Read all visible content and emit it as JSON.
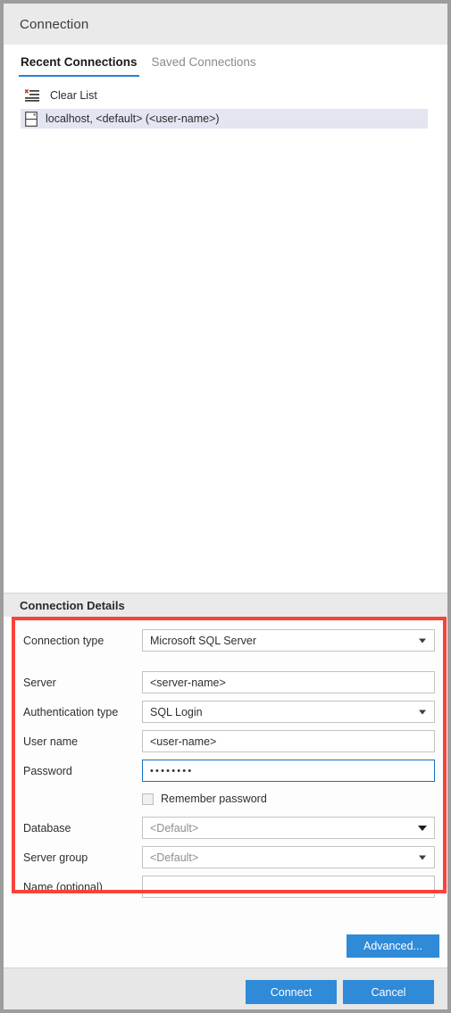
{
  "window": {
    "title": "Connection"
  },
  "tabs": [
    {
      "label": "Recent Connections",
      "active": true
    },
    {
      "label": "Saved Connections",
      "active": false
    }
  ],
  "recent": {
    "clear_list_label": "Clear List",
    "clear_list_icon": "clear-list-icon",
    "items": [
      {
        "label": "localhost, <default> (<user-name>)",
        "icon": "server-icon",
        "selected": true
      }
    ]
  },
  "details": {
    "header": "Connection Details",
    "fields": [
      {
        "label": "Connection type",
        "value": "Microsoft SQL Server",
        "type": "combo",
        "caret": "small",
        "dim": false,
        "focused": false
      },
      {
        "label": "Server",
        "value": "<server-name>",
        "type": "text",
        "caret": "none",
        "dim": false,
        "focused": false
      },
      {
        "label": "Authentication type",
        "value": "SQL Login",
        "type": "combo",
        "caret": "small",
        "dim": false,
        "focused": false
      },
      {
        "label": "User name",
        "value": "<user-name>",
        "type": "text",
        "caret": "none",
        "dim": false,
        "focused": false
      },
      {
        "label": "Password",
        "value": "••••••••",
        "type": "password",
        "caret": "none",
        "dim": false,
        "focused": true
      },
      {
        "label": "Database",
        "value": "<Default>",
        "type": "combo",
        "caret": "wide",
        "dim": true,
        "focused": false
      },
      {
        "label": "Server group",
        "value": "<Default>",
        "type": "combo",
        "caret": "small",
        "dim": true,
        "focused": false
      },
      {
        "label": "Name (optional)",
        "value": "",
        "type": "text",
        "caret": "none",
        "dim": false,
        "focused": false
      }
    ],
    "remember_password": {
      "label": "Remember password",
      "checked": false
    },
    "advanced_label": "Advanced..."
  },
  "footer": {
    "connect_label": "Connect",
    "cancel_label": "Cancel"
  },
  "colors": {
    "accent_blue": "#2f8ad8",
    "tab_underline": "#2a7fd4",
    "highlight_red": "#f9423a",
    "selection": "#e3e5f1",
    "focus_border": "#1572c4"
  }
}
